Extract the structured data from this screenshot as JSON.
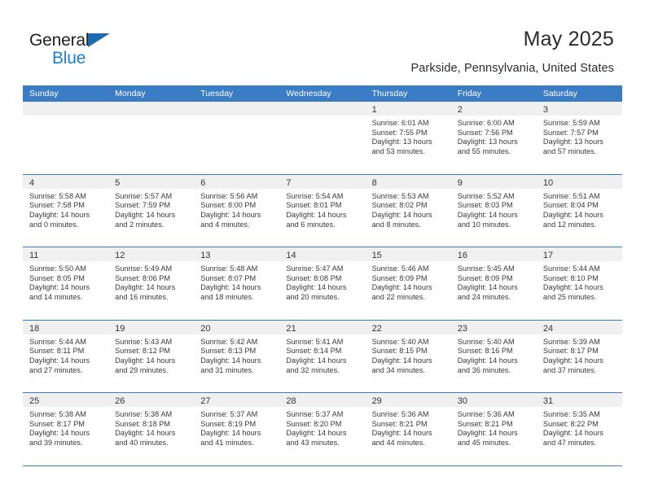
{
  "brand": {
    "name_part1": "General",
    "name_part2": "Blue",
    "accent_color": "#1b7fd4",
    "triangle_color": "#1b6cb5"
  },
  "header": {
    "title": "May 2025",
    "subtitle": "Parkside, Pennsylvania, United States",
    "header_bg_color": "#3b7dc4",
    "daynum_band_color": "#f0f0f0"
  },
  "calendar": {
    "weekdays": [
      "Sunday",
      "Monday",
      "Tuesday",
      "Wednesday",
      "Thursday",
      "Friday",
      "Saturday"
    ],
    "weeks": [
      [
        {
          "day": "",
          "lines": []
        },
        {
          "day": "",
          "lines": []
        },
        {
          "day": "",
          "lines": []
        },
        {
          "day": "",
          "lines": []
        },
        {
          "day": "1",
          "lines": [
            "Sunrise: 6:01 AM",
            "Sunset: 7:55 PM",
            "Daylight: 13 hours",
            "and 53 minutes."
          ]
        },
        {
          "day": "2",
          "lines": [
            "Sunrise: 6:00 AM",
            "Sunset: 7:56 PM",
            "Daylight: 13 hours",
            "and 55 minutes."
          ]
        },
        {
          "day": "3",
          "lines": [
            "Sunrise: 5:59 AM",
            "Sunset: 7:57 PM",
            "Daylight: 13 hours",
            "and 57 minutes."
          ]
        }
      ],
      [
        {
          "day": "4",
          "lines": [
            "Sunrise: 5:58 AM",
            "Sunset: 7:58 PM",
            "Daylight: 14 hours",
            "and 0 minutes."
          ]
        },
        {
          "day": "5",
          "lines": [
            "Sunrise: 5:57 AM",
            "Sunset: 7:59 PM",
            "Daylight: 14 hours",
            "and 2 minutes."
          ]
        },
        {
          "day": "6",
          "lines": [
            "Sunrise: 5:56 AM",
            "Sunset: 8:00 PM",
            "Daylight: 14 hours",
            "and 4 minutes."
          ]
        },
        {
          "day": "7",
          "lines": [
            "Sunrise: 5:54 AM",
            "Sunset: 8:01 PM",
            "Daylight: 14 hours",
            "and 6 minutes."
          ]
        },
        {
          "day": "8",
          "lines": [
            "Sunrise: 5:53 AM",
            "Sunset: 8:02 PM",
            "Daylight: 14 hours",
            "and 8 minutes."
          ]
        },
        {
          "day": "9",
          "lines": [
            "Sunrise: 5:52 AM",
            "Sunset: 8:03 PM",
            "Daylight: 14 hours",
            "and 10 minutes."
          ]
        },
        {
          "day": "10",
          "lines": [
            "Sunrise: 5:51 AM",
            "Sunset: 8:04 PM",
            "Daylight: 14 hours",
            "and 12 minutes."
          ]
        }
      ],
      [
        {
          "day": "11",
          "lines": [
            "Sunrise: 5:50 AM",
            "Sunset: 8:05 PM",
            "Daylight: 14 hours",
            "and 14 minutes."
          ]
        },
        {
          "day": "12",
          "lines": [
            "Sunrise: 5:49 AM",
            "Sunset: 8:06 PM",
            "Daylight: 14 hours",
            "and 16 minutes."
          ]
        },
        {
          "day": "13",
          "lines": [
            "Sunrise: 5:48 AM",
            "Sunset: 8:07 PM",
            "Daylight: 14 hours",
            "and 18 minutes."
          ]
        },
        {
          "day": "14",
          "lines": [
            "Sunrise: 5:47 AM",
            "Sunset: 8:08 PM",
            "Daylight: 14 hours",
            "and 20 minutes."
          ]
        },
        {
          "day": "15",
          "lines": [
            "Sunrise: 5:46 AM",
            "Sunset: 8:09 PM",
            "Daylight: 14 hours",
            "and 22 minutes."
          ]
        },
        {
          "day": "16",
          "lines": [
            "Sunrise: 5:45 AM",
            "Sunset: 8:09 PM",
            "Daylight: 14 hours",
            "and 24 minutes."
          ]
        },
        {
          "day": "17",
          "lines": [
            "Sunrise: 5:44 AM",
            "Sunset: 8:10 PM",
            "Daylight: 14 hours",
            "and 25 minutes."
          ]
        }
      ],
      [
        {
          "day": "18",
          "lines": [
            "Sunrise: 5:44 AM",
            "Sunset: 8:11 PM",
            "Daylight: 14 hours",
            "and 27 minutes."
          ]
        },
        {
          "day": "19",
          "lines": [
            "Sunrise: 5:43 AM",
            "Sunset: 8:12 PM",
            "Daylight: 14 hours",
            "and 29 minutes."
          ]
        },
        {
          "day": "20",
          "lines": [
            "Sunrise: 5:42 AM",
            "Sunset: 8:13 PM",
            "Daylight: 14 hours",
            "and 31 minutes."
          ]
        },
        {
          "day": "21",
          "lines": [
            "Sunrise: 5:41 AM",
            "Sunset: 8:14 PM",
            "Daylight: 14 hours",
            "and 32 minutes."
          ]
        },
        {
          "day": "22",
          "lines": [
            "Sunrise: 5:40 AM",
            "Sunset: 8:15 PM",
            "Daylight: 14 hours",
            "and 34 minutes."
          ]
        },
        {
          "day": "23",
          "lines": [
            "Sunrise: 5:40 AM",
            "Sunset: 8:16 PM",
            "Daylight: 14 hours",
            "and 36 minutes."
          ]
        },
        {
          "day": "24",
          "lines": [
            "Sunrise: 5:39 AM",
            "Sunset: 8:17 PM",
            "Daylight: 14 hours",
            "and 37 minutes."
          ]
        }
      ],
      [
        {
          "day": "25",
          "lines": [
            "Sunrise: 5:38 AM",
            "Sunset: 8:17 PM",
            "Daylight: 14 hours",
            "and 39 minutes."
          ]
        },
        {
          "day": "26",
          "lines": [
            "Sunrise: 5:38 AM",
            "Sunset: 8:18 PM",
            "Daylight: 14 hours",
            "and 40 minutes."
          ]
        },
        {
          "day": "27",
          "lines": [
            "Sunrise: 5:37 AM",
            "Sunset: 8:19 PM",
            "Daylight: 14 hours",
            "and 41 minutes."
          ]
        },
        {
          "day": "28",
          "lines": [
            "Sunrise: 5:37 AM",
            "Sunset: 8:20 PM",
            "Daylight: 14 hours",
            "and 43 minutes."
          ]
        },
        {
          "day": "29",
          "lines": [
            "Sunrise: 5:36 AM",
            "Sunset: 8:21 PM",
            "Daylight: 14 hours",
            "and 44 minutes."
          ]
        },
        {
          "day": "30",
          "lines": [
            "Sunrise: 5:36 AM",
            "Sunset: 8:21 PM",
            "Daylight: 14 hours",
            "and 45 minutes."
          ]
        },
        {
          "day": "31",
          "lines": [
            "Sunrise: 5:35 AM",
            "Sunset: 8:22 PM",
            "Daylight: 14 hours",
            "and 47 minutes."
          ]
        }
      ]
    ]
  }
}
